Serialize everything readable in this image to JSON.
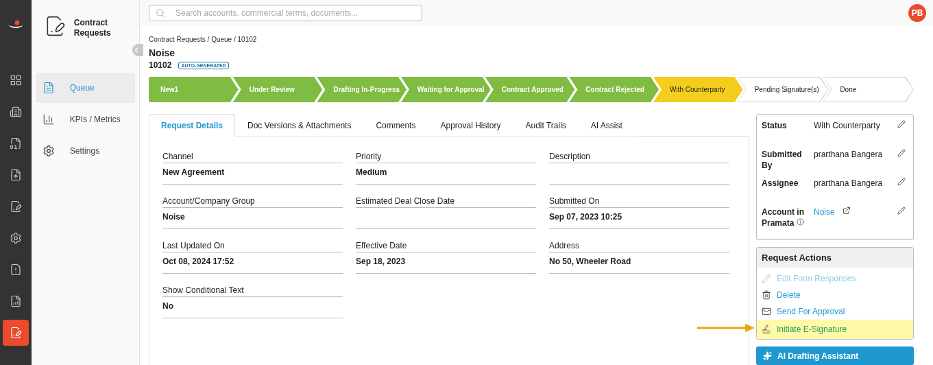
{
  "rail": [
    {
      "kind": "grid",
      "selected": false
    },
    {
      "kind": "building",
      "selected": false
    },
    {
      "kind": "money",
      "selected": false
    },
    {
      "kind": "upload",
      "selected": false
    },
    {
      "kind": "sign",
      "selected": false
    },
    {
      "kind": "gear",
      "selected": false
    },
    {
      "kind": "alert",
      "selected": false
    },
    {
      "kind": "report",
      "selected": false
    },
    {
      "kind": "sign",
      "selected": true
    }
  ],
  "module": {
    "title": "Contract Requests"
  },
  "nav": [
    {
      "kind": "queue",
      "label": "Queue",
      "selected": true
    },
    {
      "kind": "metrics",
      "label": "KPIs / Metrics",
      "selected": false
    },
    {
      "kind": "settings",
      "label": "Settings",
      "selected": false
    }
  ],
  "search": {
    "placeholder": "Search accounts, commercial terms, documents..."
  },
  "user": {
    "initials": "PB"
  },
  "breadcrumb": "Contract Requests / Queue / 10102",
  "title": "Noise",
  "record_id": "10102",
  "badge": "AUTO-GENERATED",
  "stages": [
    {
      "label": "New1",
      "kind": "done"
    },
    {
      "label": "Under Review",
      "kind": "done"
    },
    {
      "label": "Drafting In-Progress",
      "kind": "done"
    },
    {
      "label": "Waiting for Approval",
      "kind": "done"
    },
    {
      "label": "Contract Approved",
      "kind": "done"
    },
    {
      "label": "Contract Rejected",
      "kind": "done"
    },
    {
      "label": "With Counterparty",
      "kind": "current"
    },
    {
      "label": "Pending Signature(s)",
      "kind": "pending"
    },
    {
      "label": "Done",
      "kind": "pending"
    }
  ],
  "tabs": [
    {
      "label": "Request Details",
      "selected": true
    },
    {
      "label": "Doc Versions & Attachments",
      "selected": false
    },
    {
      "label": "Comments",
      "selected": false
    },
    {
      "label": "Approval History",
      "selected": false
    },
    {
      "label": "Audit Trails",
      "selected": false
    },
    {
      "label": "AI Assist",
      "selected": false
    }
  ],
  "field_columns": [
    [
      {
        "label": "Channel",
        "value": "New Agreement"
      },
      {
        "label": "Account/Company Group",
        "value": "Noise"
      },
      {
        "label": "Last Updated On",
        "value": "Oct 08, 2024 17:52"
      },
      {
        "label": "Show Conditional Text",
        "value": "No"
      }
    ],
    [
      {
        "label": "Priority",
        "value": "Medium"
      },
      {
        "label": "Estimated Deal Close Date"
      },
      {
        "label": "Effective Date",
        "value": "Sep 18, 2023"
      }
    ],
    [
      {
        "label": "Description"
      },
      {
        "label": "Submitted On",
        "value": "Sep 07, 2023 10:25"
      },
      {
        "label": "Address",
        "value": "No 50, Wheeler Road"
      }
    ]
  ],
  "summary": [
    {
      "label": "Status",
      "value": "With Counterparty",
      "kind": "text"
    },
    {
      "label": "Submitted By",
      "value": "prarthana Bangera",
      "kind": "text"
    },
    {
      "label": "Assignee",
      "value": "prarthana Bangera",
      "kind": "text"
    },
    {
      "label": "Account in Pramata",
      "value": "Noise",
      "kind": "link"
    }
  ],
  "actions": {
    "title": "Request Actions",
    "items": [
      {
        "label": "Edit Form Responses",
        "kind": "edit",
        "disabled": true,
        "highlighted": false
      },
      {
        "label": "Delete",
        "kind": "delete",
        "disabled": false,
        "highlighted": false
      },
      {
        "label": "Send For Approval",
        "kind": "mail",
        "disabled": false,
        "highlighted": false
      },
      {
        "label": "Initiate E-Signature",
        "kind": "sign",
        "disabled": false,
        "highlighted": true
      }
    ]
  },
  "ai_button": "AI Drafting Assistant"
}
